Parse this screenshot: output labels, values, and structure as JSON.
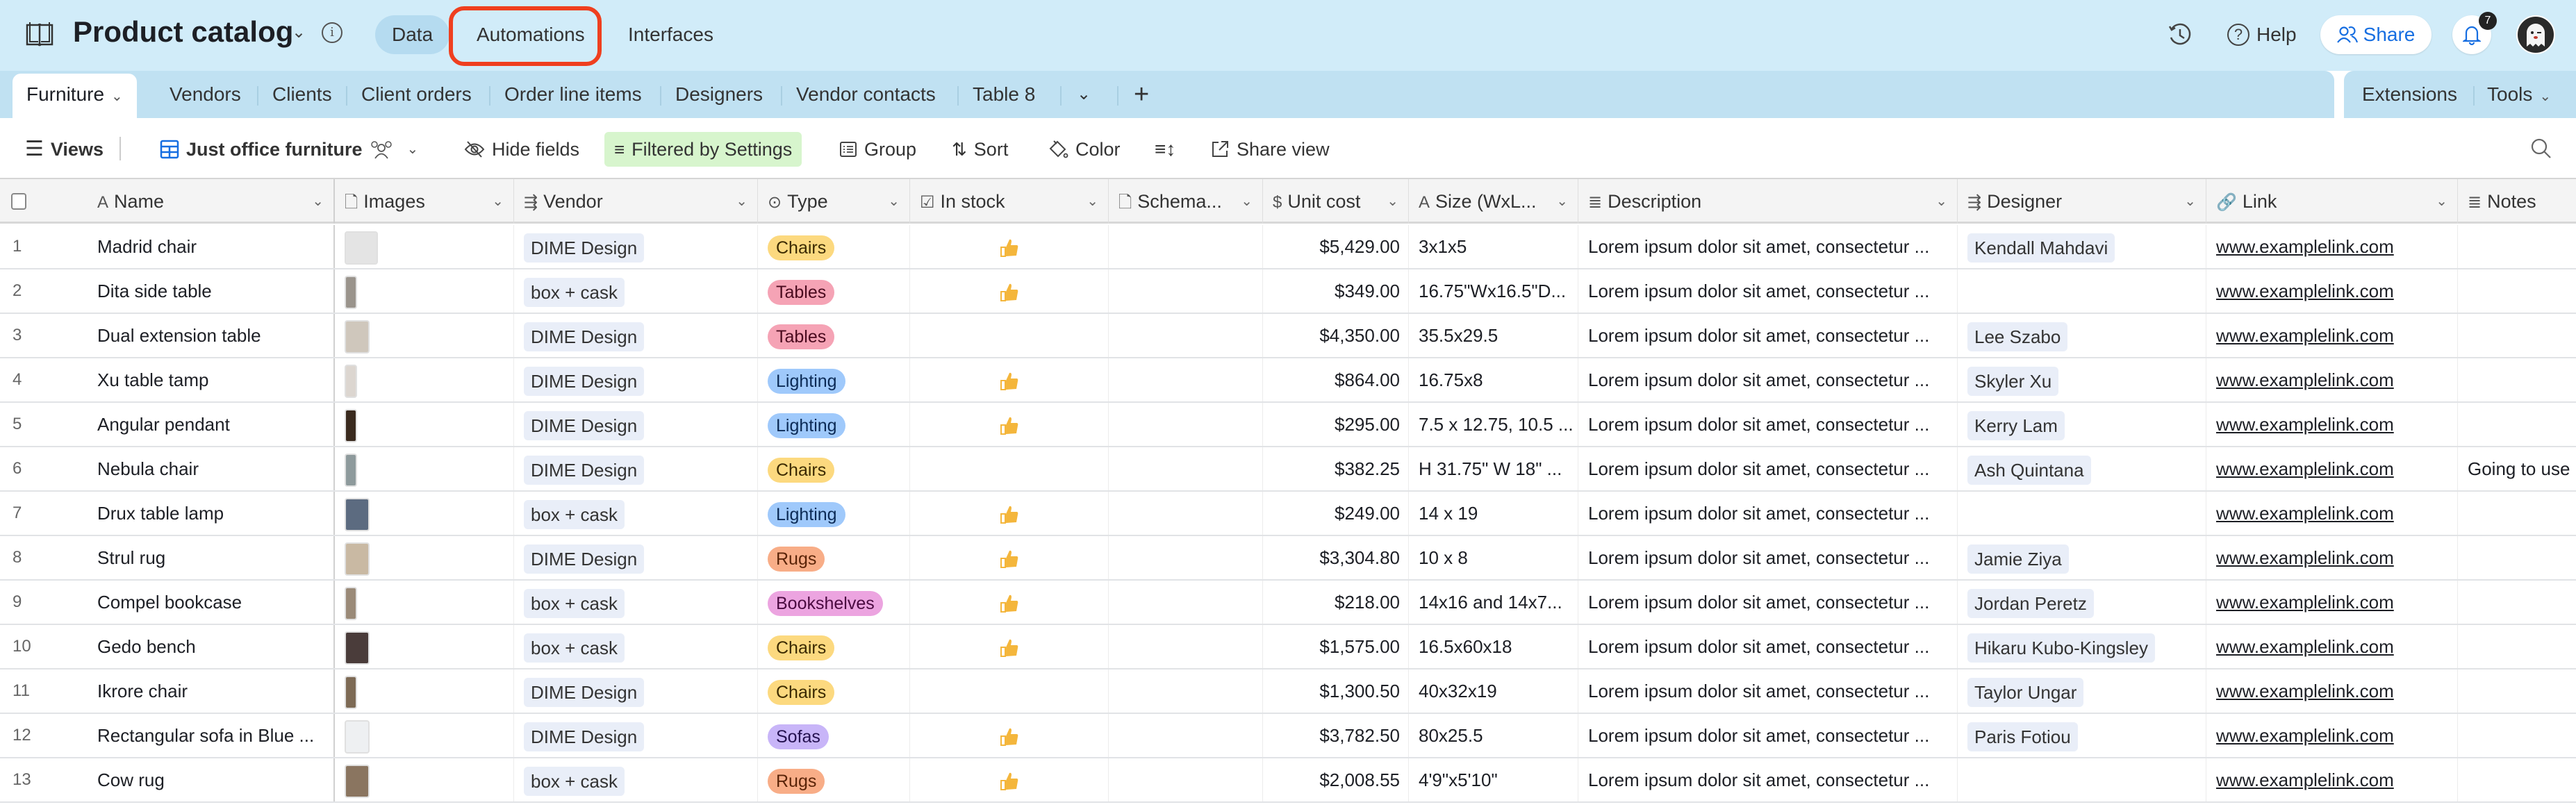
{
  "topbar": {
    "base_title": "Product catalog",
    "nav": [
      {
        "label": "Data",
        "active": true
      },
      {
        "label": "Automations",
        "active": false,
        "highlighted": true
      },
      {
        "label": "Interfaces",
        "active": false
      }
    ],
    "help_label": "Help",
    "share_label": "Share",
    "notification_count": "7",
    "icons": {
      "base": "book-icon",
      "info": "info-icon",
      "history": "history-icon",
      "help": "help-icon",
      "share": "people-icon",
      "bell": "bell-icon",
      "avatar": "ghost-avatar"
    },
    "highlight_color": "#ef3f1f",
    "background": "#d1ecf9"
  },
  "tables": {
    "tabs": [
      {
        "label": "Furniture",
        "active": true
      },
      {
        "label": "Vendors"
      },
      {
        "label": "Clients"
      },
      {
        "label": "Client orders"
      },
      {
        "label": "Order line items"
      },
      {
        "label": "Designers"
      },
      {
        "label": "Vendor contacts"
      },
      {
        "label": "Table 8"
      }
    ],
    "more_icon": "chevron-down",
    "add_icon": "plus",
    "extensions_label": "Extensions",
    "tools_label": "Tools"
  },
  "toolbar": {
    "views_label": "Views",
    "view_name": "Just office furniture",
    "hide_fields_label": "Hide fields",
    "filter_label": "Filtered by Settings",
    "group_label": "Group",
    "sort_label": "Sort",
    "color_label": "Color",
    "share_view_label": "Share view",
    "filter_bg": "#d7f5cd"
  },
  "columns": [
    {
      "key": "name",
      "label": "Name",
      "icon": "A"
    },
    {
      "key": "images",
      "label": "Images",
      "icon": "file"
    },
    {
      "key": "vendor",
      "label": "Vendor",
      "icon": "link-record"
    },
    {
      "key": "type",
      "label": "Type",
      "icon": "single-select"
    },
    {
      "key": "in_stock",
      "label": "In stock",
      "icon": "checkbox"
    },
    {
      "key": "schema",
      "label": "Schema...",
      "icon": "file"
    },
    {
      "key": "unit_cost",
      "label": "Unit cost",
      "icon": "currency"
    },
    {
      "key": "size",
      "label": "Size (WxL...",
      "icon": "A"
    },
    {
      "key": "description",
      "label": "Description",
      "icon": "long-text"
    },
    {
      "key": "designer",
      "label": "Designer",
      "icon": "link-record"
    },
    {
      "key": "link",
      "label": "Link",
      "icon": "url"
    },
    {
      "key": "notes",
      "label": "Notes",
      "icon": "long-text"
    }
  ],
  "type_colors": {
    "Chairs": {
      "bg": "#fcd97f",
      "fg": "#3b2a00"
    },
    "Tables": {
      "bg": "#f5a3b5",
      "fg": "#4a0a1e"
    },
    "Lighting": {
      "bg": "#9fc9fb",
      "fg": "#0b2a55"
    },
    "Rugs": {
      "bg": "#f8ad87",
      "fg": "#5a2408"
    },
    "Bookshelves": {
      "bg": "#eca4e0",
      "fg": "#4a0a40"
    },
    "Sofas": {
      "bg": "#c8b5f8",
      "fg": "#24114f"
    }
  },
  "rows": [
    {
      "num": "1",
      "name": "Madrid chair",
      "thumb": {
        "w": 2.4,
        "color": "#e4e4e4"
      },
      "vendor": "DIME Design",
      "type": "Chairs",
      "in_stock": true,
      "unit_cost": "$5,429.00",
      "size": "3x1x5",
      "description": "Lorem ipsum dolor sit amet, consectetur ...",
      "designer": "Kendall Mahdavi",
      "link": "www.examplelink.com",
      "notes": ""
    },
    {
      "num": "2",
      "name": "Dita side table",
      "thumb": {
        "w": 0.9,
        "color": "#9a948c"
      },
      "vendor": "box + cask",
      "type": "Tables",
      "in_stock": true,
      "unit_cost": "$349.00",
      "size": "16.75\"Wx16.5\"D...",
      "description": "Lorem ipsum dolor sit amet, consectetur ...",
      "designer": "",
      "link": "www.examplelink.com",
      "notes": ""
    },
    {
      "num": "3",
      "name": "Dual extension table",
      "thumb": {
        "w": 1.8,
        "color": "#cfc7bc"
      },
      "vendor": "DIME Design",
      "type": "Tables",
      "in_stock": false,
      "unit_cost": "$4,350.00",
      "size": "35.5x29.5",
      "description": "Lorem ipsum dolor sit amet, consectetur ...",
      "designer": "Lee Szabo",
      "link": "www.examplelink.com",
      "notes": ""
    },
    {
      "num": "4",
      "name": "Xu table tamp",
      "thumb": {
        "w": 0.9,
        "color": "#dcd6d0"
      },
      "vendor": "DIME Design",
      "type": "Lighting",
      "in_stock": true,
      "unit_cost": "$864.00",
      "size": "16.75x8",
      "description": "Lorem ipsum dolor sit amet, consectetur ...",
      "designer": "Skyler Xu",
      "link": "www.examplelink.com",
      "notes": ""
    },
    {
      "num": "5",
      "name": "Angular pendant",
      "thumb": {
        "w": 0.9,
        "color": "#3a2a1e"
      },
      "vendor": "DIME Design",
      "type": "Lighting",
      "in_stock": true,
      "unit_cost": "$295.00",
      "size": "7.5 x 12.75, 10.5 ...",
      "description": "Lorem ipsum dolor sit amet, consectetur ...",
      "designer": "Kerry Lam",
      "link": "www.examplelink.com",
      "notes": ""
    },
    {
      "num": "6",
      "name": "Nebula chair",
      "thumb": {
        "w": 0.9,
        "color": "#8e9a9c"
      },
      "vendor": "DIME Design",
      "type": "Chairs",
      "in_stock": false,
      "unit_cost": "$382.25",
      "size": "H 31.75\" W 18\" ...",
      "description": "Lorem ipsum dolor sit amet, consectetur ...",
      "designer": "Ash Quintana",
      "link": "www.examplelink.com",
      "notes": "Going to use"
    },
    {
      "num": "7",
      "name": "Drux table lamp",
      "thumb": {
        "w": 1.8,
        "color": "#5c6b80"
      },
      "vendor": "box + cask",
      "type": "Lighting",
      "in_stock": true,
      "unit_cost": "$249.00",
      "size": "14 x 19",
      "description": "Lorem ipsum dolor sit amet, consectetur ...",
      "designer": "",
      "link": "www.examplelink.com",
      "notes": ""
    },
    {
      "num": "8",
      "name": "Strul rug",
      "thumb": {
        "w": 1.8,
        "color": "#c9b9a3"
      },
      "vendor": "DIME Design",
      "type": "Rugs",
      "in_stock": true,
      "unit_cost": "$3,304.80",
      "size": "10 x 8",
      "description": "Lorem ipsum dolor sit amet, consectetur ...",
      "designer": "Jamie Ziya",
      "link": "www.examplelink.com",
      "notes": ""
    },
    {
      "num": "9",
      "name": "Compel bookcase",
      "thumb": {
        "w": 0.9,
        "color": "#9a8a78"
      },
      "vendor": "box + cask",
      "type": "Bookshelves",
      "in_stock": true,
      "unit_cost": "$218.00",
      "size": "14x16 and 14x7...",
      "description": "Lorem ipsum dolor sit amet, consectetur ...",
      "designer": "Jordan Peretz",
      "link": "www.examplelink.com",
      "notes": ""
    },
    {
      "num": "10",
      "name": "Gedo bench",
      "thumb": {
        "w": 1.8,
        "color": "#4a3c3a"
      },
      "vendor": "box + cask",
      "type": "Chairs",
      "in_stock": true,
      "unit_cost": "$1,575.00",
      "size": "16.5x60x18",
      "description": "Lorem ipsum dolor sit amet, consectetur ...",
      "designer": "Hikaru Kubo-Kingsley",
      "link": "www.examplelink.com",
      "notes": ""
    },
    {
      "num": "11",
      "name": "Ikrore chair",
      "thumb": {
        "w": 0.9,
        "color": "#7d6a55"
      },
      "vendor": "DIME Design",
      "type": "Chairs",
      "in_stock": false,
      "unit_cost": "$1,300.50",
      "size": "40x32x19",
      "description": "Lorem ipsum dolor sit amet, consectetur ...",
      "designer": "Taylor Ungar",
      "link": "www.examplelink.com",
      "notes": ""
    },
    {
      "num": "12",
      "name": "Rectangular sofa in Blue ...",
      "thumb": {
        "w": 1.8,
        "color": "#eef0f2"
      },
      "vendor": "DIME Design",
      "type": "Sofas",
      "in_stock": true,
      "unit_cost": "$3,782.50",
      "size": "80x25.5",
      "description": "Lorem ipsum dolor sit amet, consectetur ...",
      "designer": "Paris Fotiou",
      "link": "www.examplelink.com",
      "notes": ""
    },
    {
      "num": "13",
      "name": "Cow rug",
      "thumb": {
        "w": 1.8,
        "color": "#8a7560"
      },
      "vendor": "box + cask",
      "type": "Rugs",
      "in_stock": true,
      "unit_cost": "$2,008.55",
      "size": "4'9\"x5'10\"",
      "description": "Lorem ipsum dolor sit amet, consectetur ...",
      "designer": "",
      "link": "www.examplelink.com",
      "notes": ""
    }
  ]
}
